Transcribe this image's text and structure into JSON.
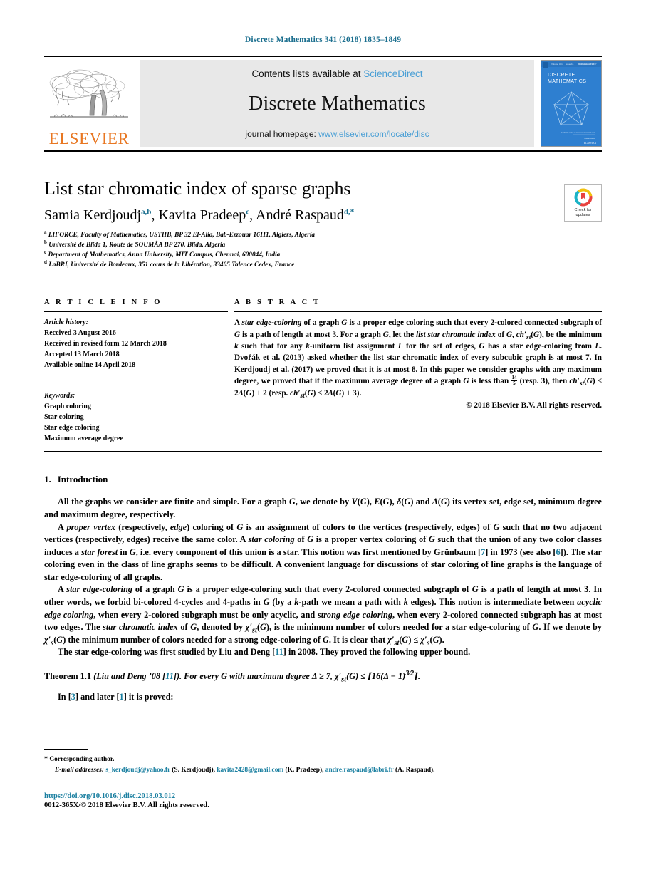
{
  "running_head": "Discrete Mathematics 341 (2018) 1835–1849",
  "masthead": {
    "contents_prefix": "Contents lists available at ",
    "contents_link": "ScienceDirect",
    "journal_name": "Discrete Mathematics",
    "homepage_prefix": "journal homepage: ",
    "homepage_link": "www.elsevier.com/locate/disc",
    "publisher": "ELSEVIER",
    "cover_title_line1": "DISCRETE",
    "cover_title_line2": "MATHEMATICS"
  },
  "article": {
    "title": "List star chromatic index of sparse graphs",
    "authors": [
      {
        "name": "Samia Kerdjoudj",
        "marks": "a,b"
      },
      {
        "name": "Kavita Pradeep",
        "marks": "c"
      },
      {
        "name": "André Raspaud",
        "marks": "d,*"
      }
    ],
    "affiliations": [
      {
        "key": "a",
        "text": "LIFORCE, Faculty of Mathematics, USTHB, BP 32 El-Alia, Bab-Ezzouar 16111, Algiers, Algeria"
      },
      {
        "key": "b",
        "text": "Université de Blida 1, Route de SOUMÂA BP 270, Blida, Algeria"
      },
      {
        "key": "c",
        "text": "Department of Mathematics, Anna University, MIT Campus, Chennai, 600044, India"
      },
      {
        "key": "d",
        "text": "LaBRI, Université de Bordeaux, 351 cours de la Libération, 33405 Talence Cedex, France"
      }
    ],
    "crossmark_line1": "Check for",
    "crossmark_line2": "updates"
  },
  "info": {
    "heading": "A R T I C L E   I N F O",
    "history_label": "Article history:",
    "history": [
      "Received 3 August 2016",
      "Received in revised form 12 March 2018",
      "Accepted 13 March 2018",
      "Available online 14 April 2018"
    ],
    "keywords_label": "Keywords:",
    "keywords": [
      "Graph coloring",
      "Star coloring",
      "Star edge coloring",
      "Maximum average degree"
    ]
  },
  "abstract": {
    "heading": "A B S T R A C T",
    "copyright": "© 2018 Elsevier B.V. All rights reserved."
  },
  "body": {
    "section_number": "1.",
    "section_title": "Introduction",
    "theorem_label": "Theorem 1.1",
    "theorem_attrib_open": "(Liu and Deng ’08 [",
    "theorem_attrib_ref": "11",
    "theorem_attrib_close": "])."
  },
  "footnotes": {
    "corresponding": "Corresponding author.",
    "email_label": "E-mail addresses:",
    "emails": [
      {
        "address": "s_kerdjoudj@yahoo.fr",
        "owner": "(S. Kerdjoudj)"
      },
      {
        "address": "kavita2428@gmail.com",
        "owner": "(K. Pradeep)"
      },
      {
        "address": "andre.raspaud@labri.fr",
        "owner": "(A. Raspaud)"
      }
    ],
    "doi": "https://doi.org/10.1016/j.disc.2018.03.012",
    "issn_line": "0012-365X/© 2018 Elsevier B.V. All rights reserved."
  },
  "colors": {
    "link_blue": "#4a9fd5",
    "ref_blue": "#1a7fa0",
    "runhead_blue": "#1a6e8e",
    "elsevier_orange": "#E87722",
    "cover_blue": "#2e7fd0"
  }
}
